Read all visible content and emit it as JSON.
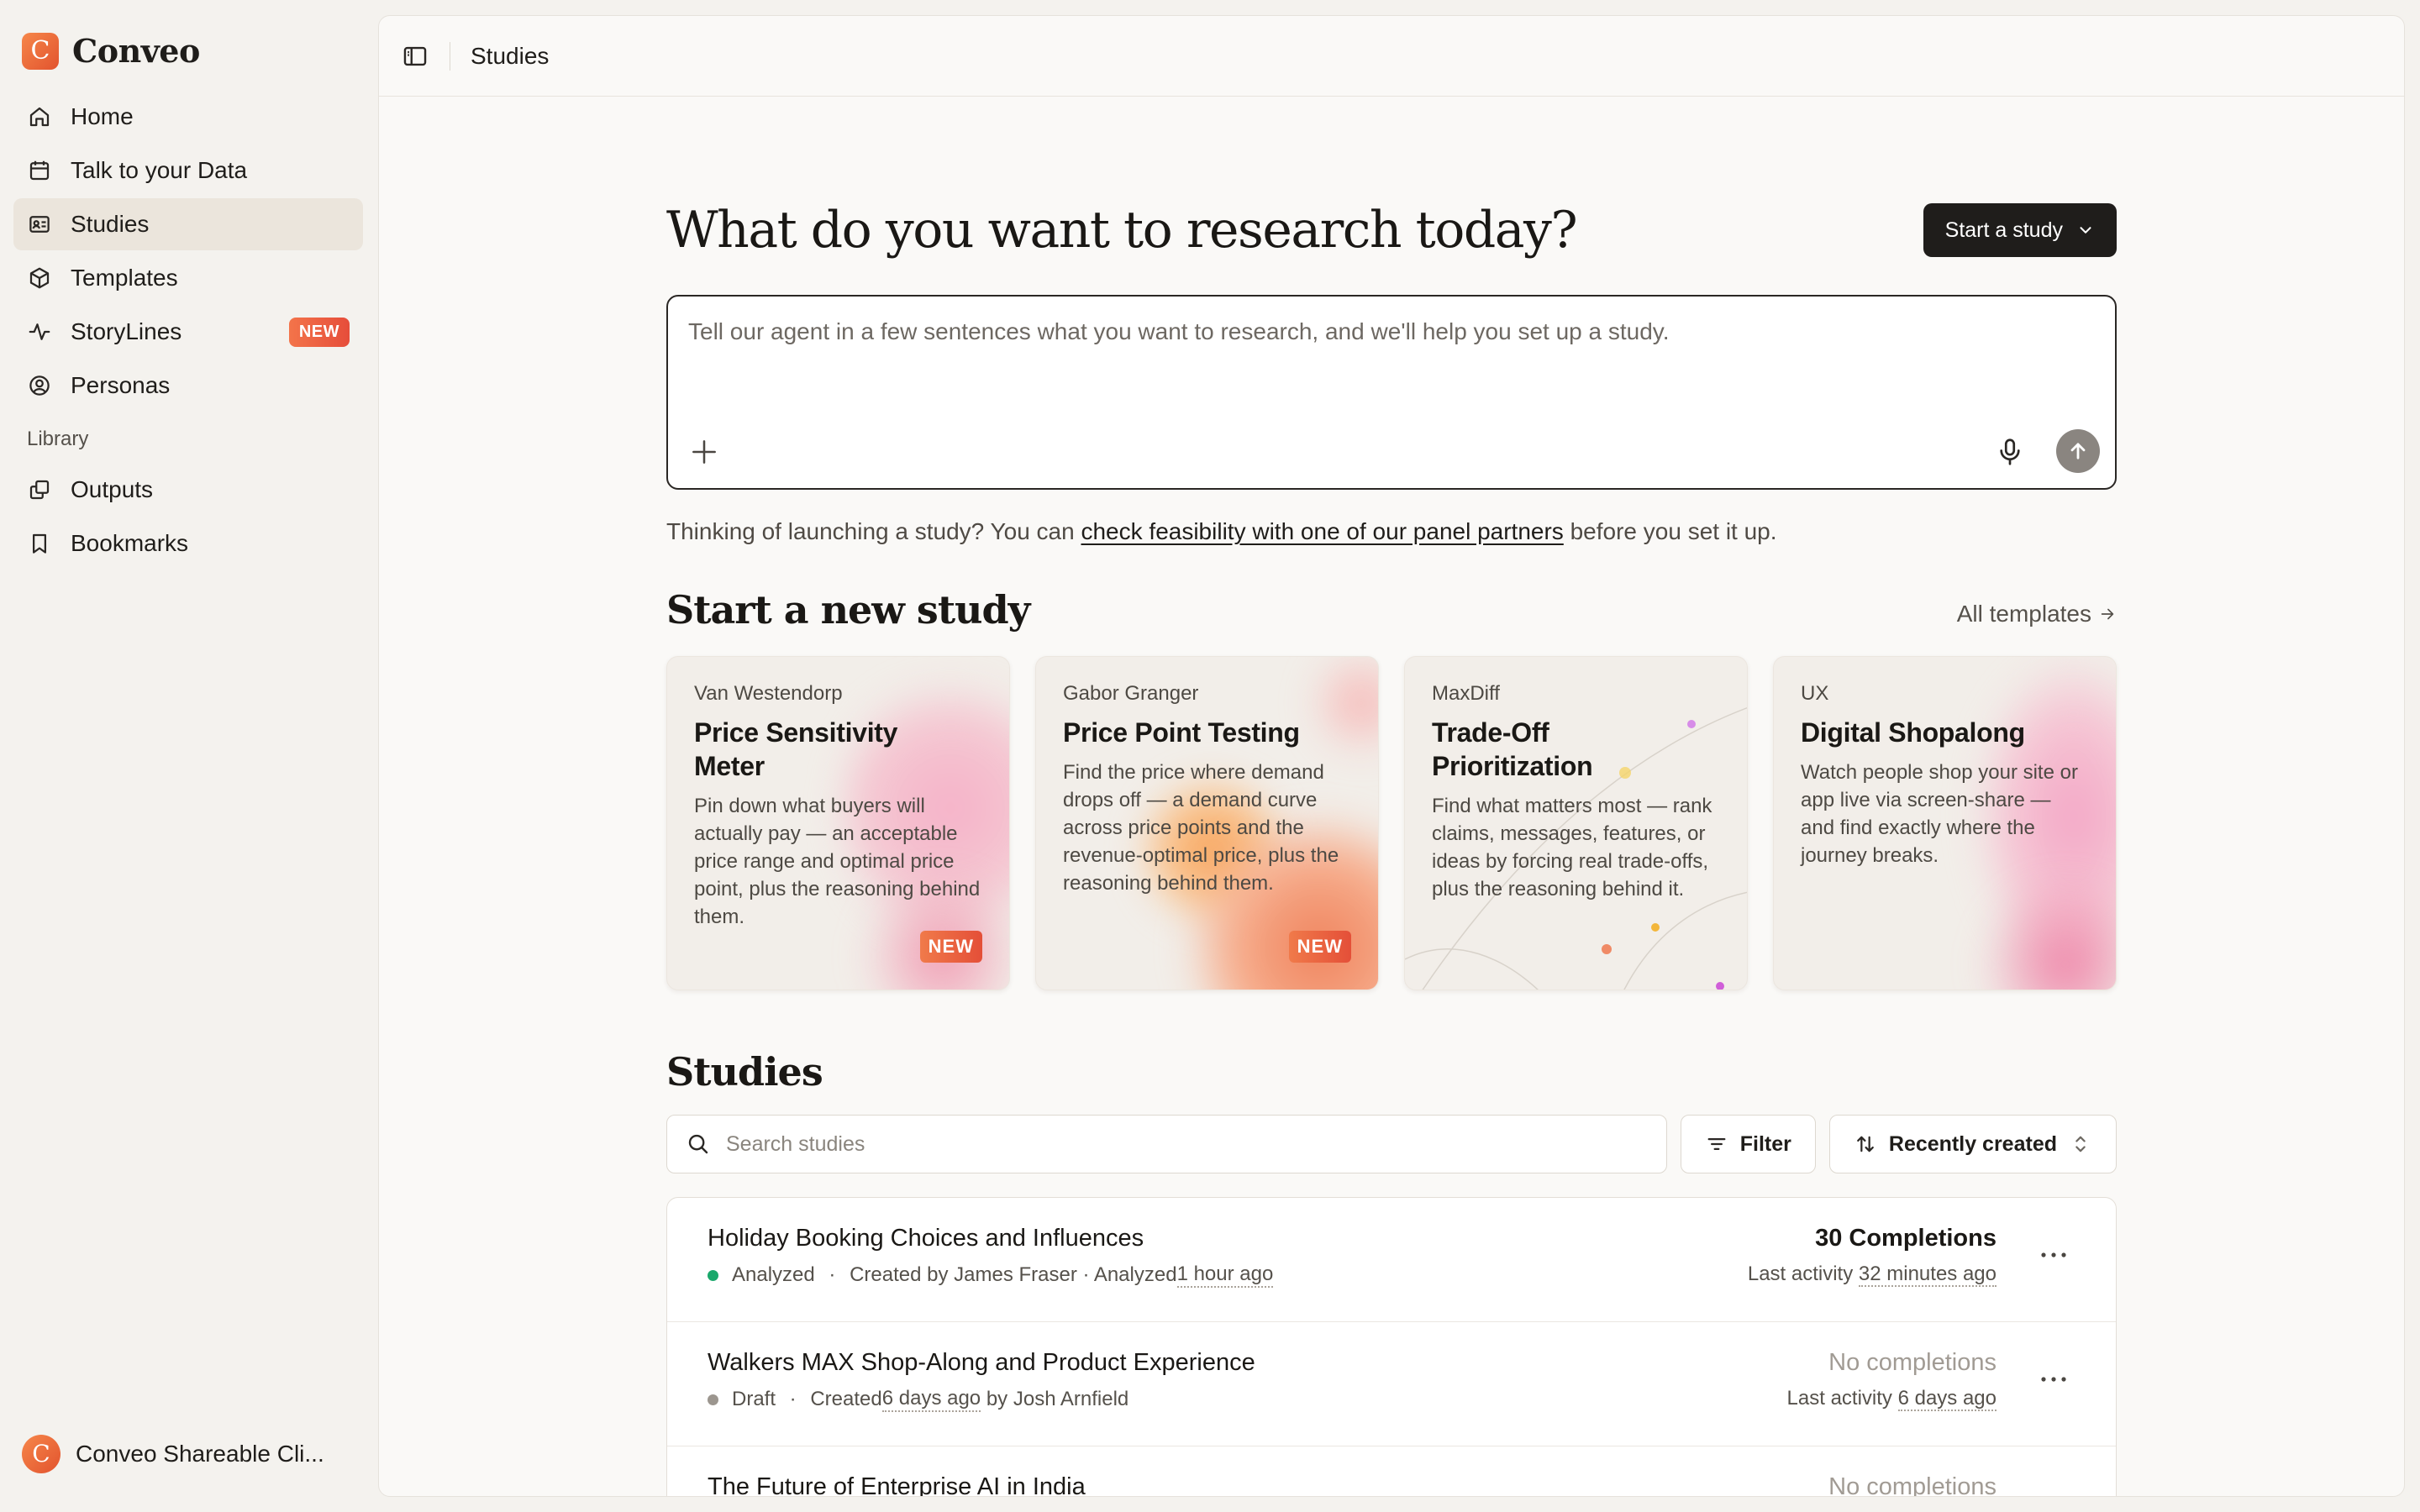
{
  "brand": {
    "name": "Conveo",
    "logo_letter": "C",
    "accent": "#e8582f"
  },
  "sidebar": {
    "items": [
      {
        "label": "Home",
        "icon": "home-icon"
      },
      {
        "label": "Talk to your Data",
        "icon": "calendar-grid-icon"
      },
      {
        "label": "Studies",
        "icon": "id-card-icon",
        "active": true
      },
      {
        "label": "Templates",
        "icon": "box-icon"
      },
      {
        "label": "StoryLines",
        "icon": "pulse-icon",
        "badge": "NEW"
      },
      {
        "label": "Personas",
        "icon": "user-circle-icon"
      }
    ],
    "library_heading": "Library",
    "library_items": [
      {
        "label": "Outputs",
        "icon": "copy-icon"
      },
      {
        "label": "Bookmarks",
        "icon": "bookmark-icon"
      }
    ],
    "workspace": {
      "name": "Conveo Shareable Cli...",
      "logo_letter": "C"
    }
  },
  "topbar": {
    "breadcrumb": "Studies"
  },
  "hero": {
    "title": "What do you want to research today?",
    "start_button": "Start a study",
    "composer_placeholder": "Tell our agent in a few sentences what you want to research, and we'll help you set up a study.",
    "hint_prefix": "Thinking of launching a study? You can ",
    "hint_link": "check feasibility with one of our panel partners",
    "hint_suffix": " before you set it up."
  },
  "templates_section": {
    "title": "Start a new study",
    "all_link": "All templates",
    "cards": [
      {
        "kicker": "Van Westendorp",
        "title": "Price Sensitivity Meter",
        "description": "Pin down what buyers will actually pay — an acceptable price range and optimal price point, plus the reasoning behind them.",
        "badge": "NEW"
      },
      {
        "kicker": "Gabor Granger",
        "title": "Price Point Testing",
        "description": "Find the price where demand drops off — a demand curve across price points and the revenue-optimal price, plus the reasoning behind them.",
        "badge": "NEW"
      },
      {
        "kicker": "MaxDiff",
        "title": "Trade-Off Prioritization",
        "description": "Find what matters most — rank claims, messages, features, or ideas by forcing real trade-offs, plus the reasoning behind it.",
        "badge": ""
      },
      {
        "kicker": "UX",
        "title": "Digital Shopalong",
        "description": "Watch people shop your site or app live via screen-share — and find exactly where the journey breaks.",
        "badge": ""
      }
    ]
  },
  "studies": {
    "title": "Studies",
    "search_placeholder": "Search studies",
    "filter_label": "Filter",
    "sort_label": "Recently created",
    "rows": [
      {
        "title": "Holiday Booking Choices and Influences",
        "status": "Analyzed",
        "status_color": "#1aa86b",
        "meta_a": "Created by James Fraser · Analyzed ",
        "meta_time": "1 hour ago",
        "meta_b": "",
        "completions": "30 Completions",
        "activity_label": "Last activity ",
        "activity_time": "32 minutes ago"
      },
      {
        "title": "Walkers MAX Shop-Along and Product Experience",
        "status": "Draft",
        "status_color": "#9c968f",
        "meta_a": "Created ",
        "meta_time": "6 days ago",
        "meta_b": " by Josh Arnfield",
        "completions": "No completions",
        "activity_label": "Last activity ",
        "activity_time": "6 days ago"
      },
      {
        "title": "The Future of Enterprise AI in India",
        "status": "",
        "status_color": "#9c968f",
        "meta_a": "",
        "meta_time": "",
        "meta_b": "",
        "completions": "No completions",
        "activity_label": "",
        "activity_time": ""
      }
    ]
  }
}
